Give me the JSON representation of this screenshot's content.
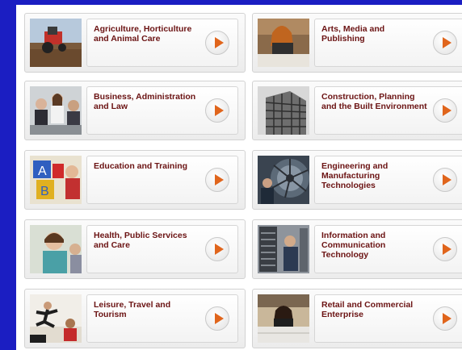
{
  "tiles": [
    {
      "label": "Agriculture, Horticulture and Animal Care",
      "icon": "tractor-photo-icon"
    },
    {
      "label": "Arts, Media and Publishing",
      "icon": "art-student-photo-icon"
    },
    {
      "label": "Business, Administration and Law",
      "icon": "business-meeting-photo-icon"
    },
    {
      "label": "Construction, Planning and the Built Environment",
      "icon": "building-photo-icon"
    },
    {
      "label": "Education and Training",
      "icon": "alphabet-blocks-photo-icon"
    },
    {
      "label": "Engineering and Manufacturing Technologies",
      "icon": "jet-engine-photo-icon"
    },
    {
      "label": "Health, Public Services and Care",
      "icon": "smiling-nurse-photo-icon"
    },
    {
      "label": "Information and Communication Technology",
      "icon": "server-room-photo-icon"
    },
    {
      "label": "Leisure, Travel and Tourism",
      "icon": "sports-photo-icon"
    },
    {
      "label": "Retail and Commercial Enterprise",
      "icon": "shop-counter-photo-icon"
    }
  ],
  "colors": {
    "background": "#1b1ec2",
    "label_text": "#6b1313",
    "play_arrow": "#e0651c"
  }
}
